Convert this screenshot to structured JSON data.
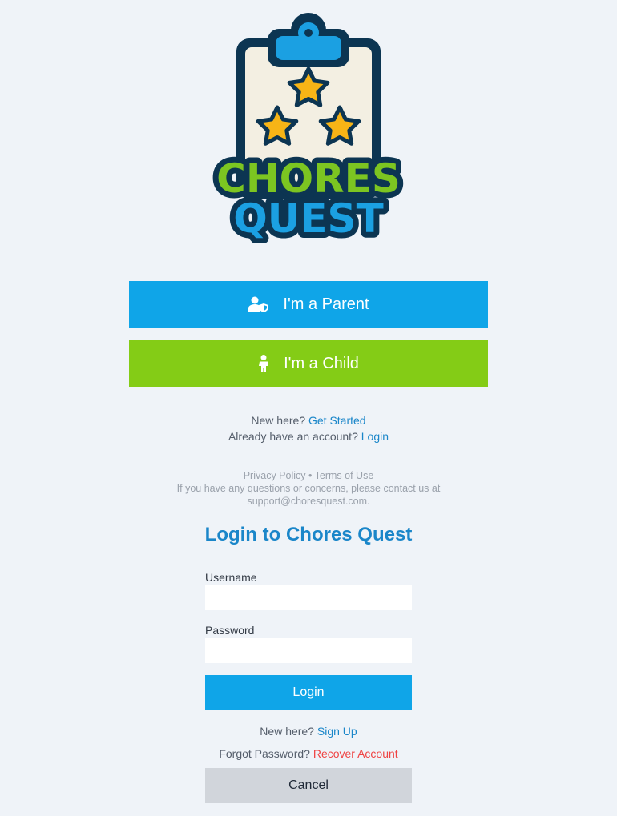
{
  "logo": {
    "line1": "CHORES",
    "line2": "QUEST",
    "icon": "clipboard-stars-logo"
  },
  "roles": {
    "parent": {
      "label": "I'm a Parent",
      "icon": "parent-shield-icon"
    },
    "child": {
      "label": "I'm a Child",
      "icon": "child-icon"
    }
  },
  "onboarding": {
    "new_prefix": "New here?",
    "get_started": "Get Started",
    "existing_prefix": "Already have an account?",
    "login_link": "Login"
  },
  "footer": {
    "privacy": "Privacy Policy",
    "sep": "•",
    "terms": "Terms of Use",
    "contact_line1": "If you have any questions or concerns, please contact us at",
    "contact_line2": "support@choresquest.com."
  },
  "login_form": {
    "title": "Login to Chores Quest",
    "username_label": "Username",
    "username_value": "",
    "password_label": "Password",
    "password_value": "",
    "submit": "Login",
    "signup_prefix": "New here?",
    "signup_link": "Sign Up",
    "forgot_prefix": "Forgot Password?",
    "recover_link": "Recover Account",
    "cancel": "Cancel"
  },
  "colors": {
    "primary": "#0fa5e8",
    "child": "#84cc16",
    "link": "#1a86c9",
    "danger": "#ef4444",
    "background": "#eff3f8",
    "logo_outline": "#0c3552"
  }
}
